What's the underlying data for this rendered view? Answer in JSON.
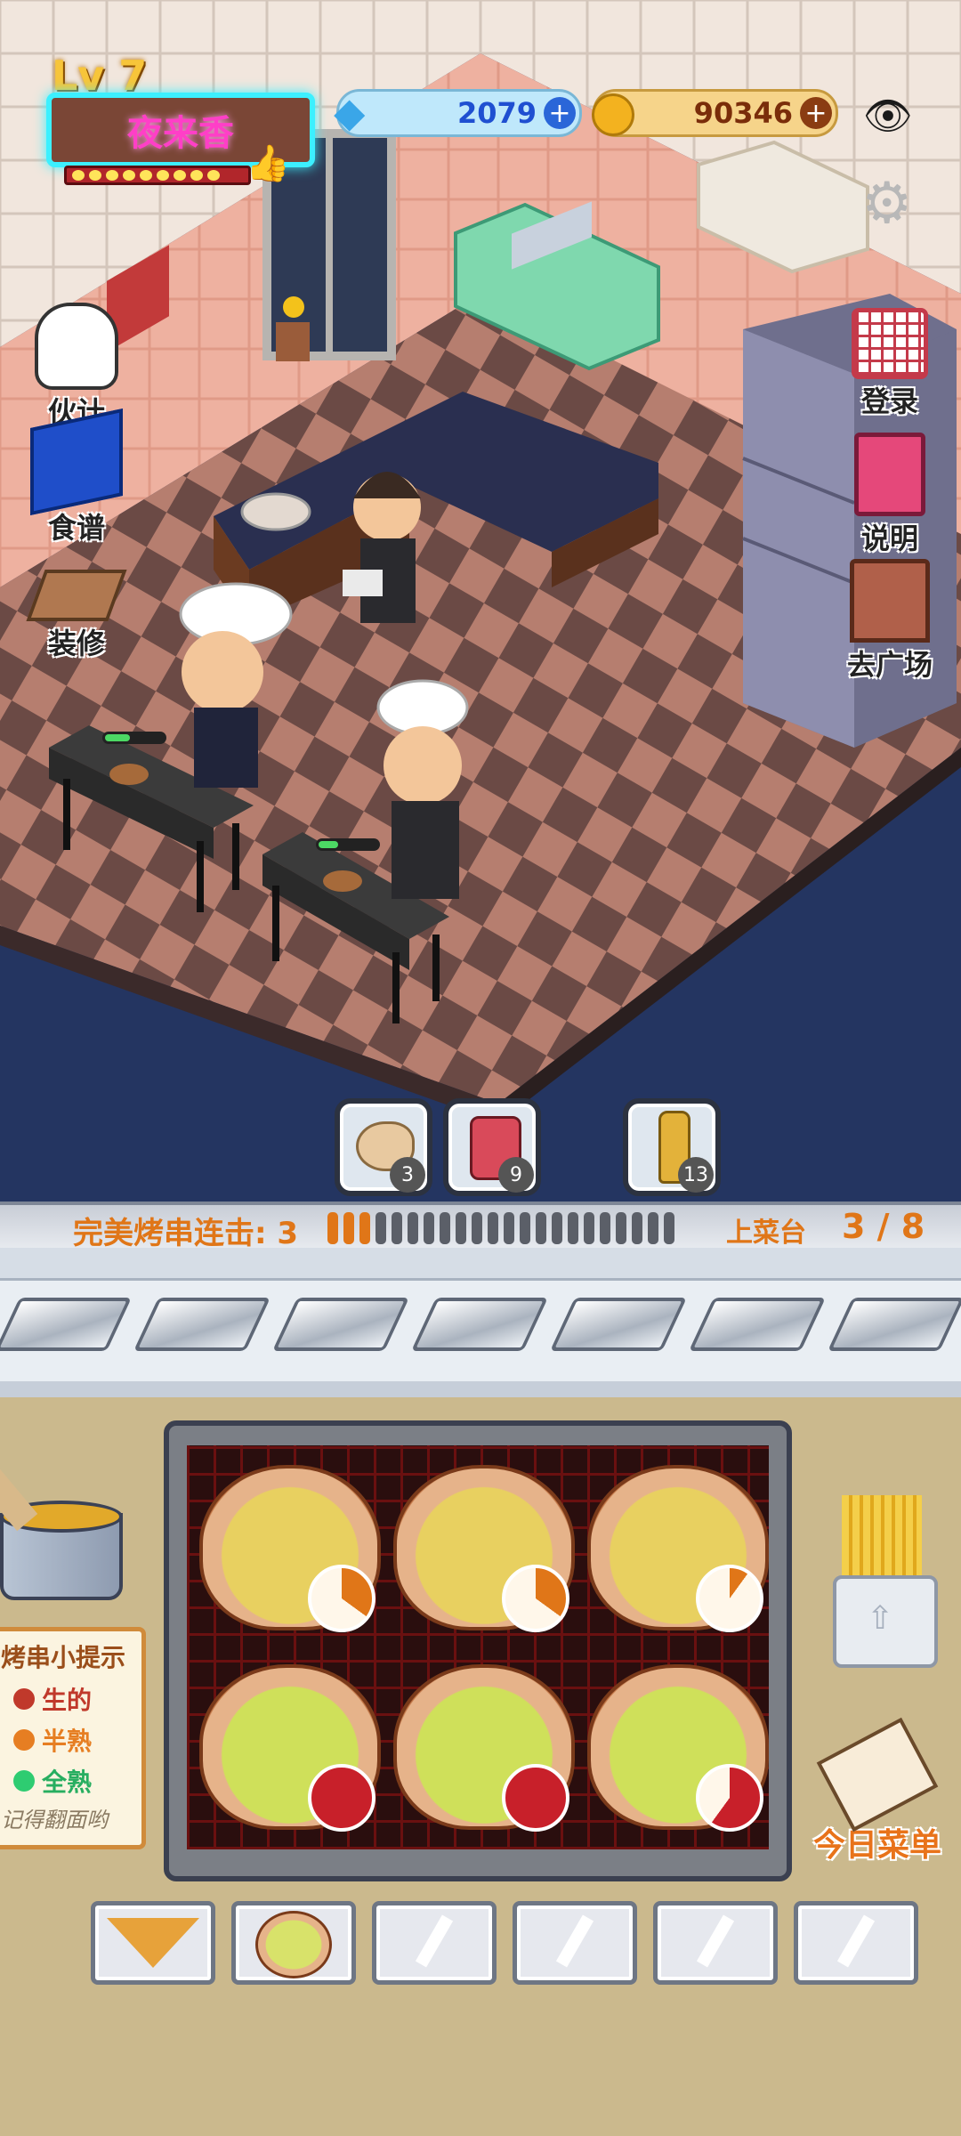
{
  "hud": {
    "level": "Lv 7",
    "shop_name": "夜来香",
    "progress_dots": 9,
    "gems": "2079",
    "coins": "90346"
  },
  "left_menu": [
    {
      "label": "伙计",
      "icon": "chef-hat-icon"
    },
    {
      "label": "食谱",
      "icon": "recipe-book-icon"
    },
    {
      "label": "装修",
      "icon": "decorate-table-icon"
    }
  ],
  "right_menu": [
    {
      "label": "登录",
      "icon": "calendar-icon"
    },
    {
      "label": "说明",
      "icon": "manual-book-icon"
    },
    {
      "label": "去广场",
      "icon": "door-icon"
    }
  ],
  "ingredients": [
    {
      "name": "dough",
      "count": "3"
    },
    {
      "name": "sauce-jar",
      "count": "9"
    },
    {
      "name": "beer-bottle",
      "count": "13"
    }
  ],
  "combo": {
    "label": "完美烤串连击: 3",
    "filled": 3,
    "total": 22,
    "counter_label": "上菜台",
    "counter_value": "3 / 8"
  },
  "tips": {
    "title": "烤串小提示",
    "items": [
      {
        "label": "生的",
        "color": "#c0392b"
      },
      {
        "label": "半熟",
        "color": "#e67e22"
      },
      {
        "label": "全熟",
        "color": "#2ecc71"
      }
    ],
    "note": "记得翻面哟"
  },
  "grill": {
    "cells": [
      {
        "doneness": 0.35,
        "side": "top"
      },
      {
        "doneness": 0.35,
        "side": "top"
      },
      {
        "doneness": 0.1,
        "side": "top"
      },
      {
        "doneness": 1.0,
        "side": "bottom"
      },
      {
        "doneness": 1.0,
        "side": "bottom"
      },
      {
        "doneness": 0.6,
        "side": "bottom"
      }
    ]
  },
  "menu_today": "今日菜单",
  "tray_slots": [
    "pizza-slice",
    "scallop",
    "",
    "",
    "",
    ""
  ],
  "colors": {
    "accent_orange": "#e07618",
    "gem_bar": "#bfe8fb",
    "coin_bar": "#f6d48a",
    "neon_pink": "#ff3fc7"
  }
}
